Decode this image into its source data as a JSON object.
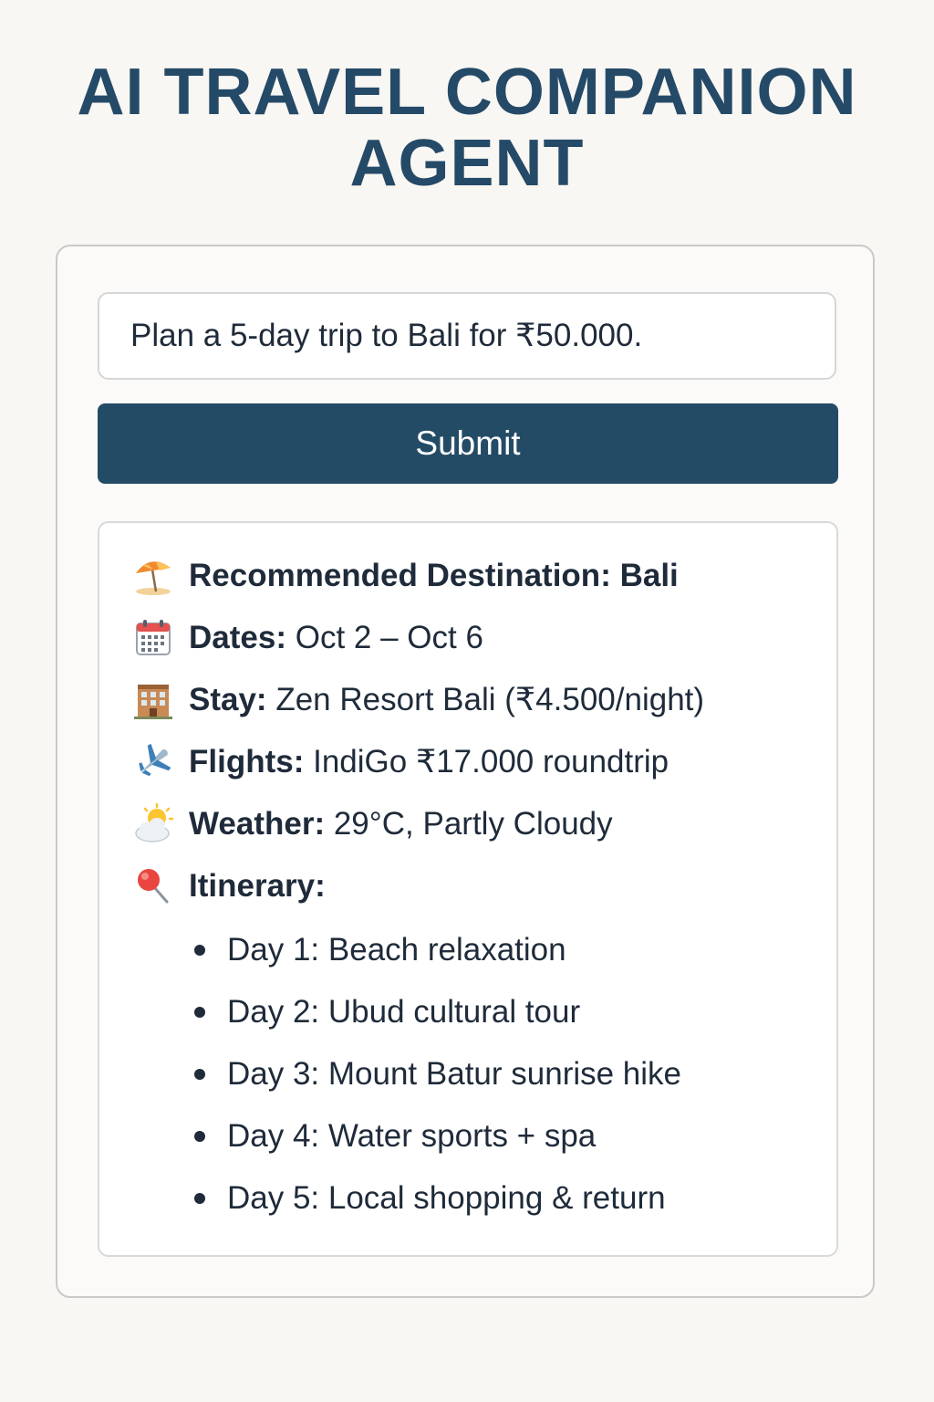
{
  "header": {
    "title_line1": "AI TRAVEL COMPANION",
    "title_line2": "AGENT"
  },
  "query": {
    "value": "Plan a 5-day trip to Bali for ₹50.000."
  },
  "submit": {
    "label": "Submit"
  },
  "result": {
    "destination": {
      "icon": "beach-umbrella-icon",
      "label": "Recommended Destination:",
      "value": "Bali"
    },
    "dates": {
      "icon": "calendar-icon",
      "label": "Dates:",
      "value": "Oct 2 – Oct 6"
    },
    "stay": {
      "icon": "hotel-icon",
      "label": "Stay:",
      "value": "Zen Resort Bali (₹4.500/night)"
    },
    "flights": {
      "icon": "airplane-icon",
      "label": "Flights:",
      "value": "IndiGo ₹17.000 roundtrip"
    },
    "weather": {
      "icon": "sun-behind-cloud-icon",
      "label": "Weather:",
      "value": "29°C, Partly Cloudy"
    },
    "itinerary": {
      "icon": "pushpin-icon",
      "label": "Itinerary:",
      "days": [
        "Day 1: Beach relaxation",
        "Day 2: Ubud cultural tour",
        "Day 3: Mount Batur sunrise hike",
        "Day 4: Water sports + spa",
        "Day 5: Local shopping & return"
      ]
    }
  },
  "colors": {
    "background": "#f9f7f3",
    "title": "#254a68",
    "button": "#244b66",
    "text": "#1f2b3a"
  }
}
